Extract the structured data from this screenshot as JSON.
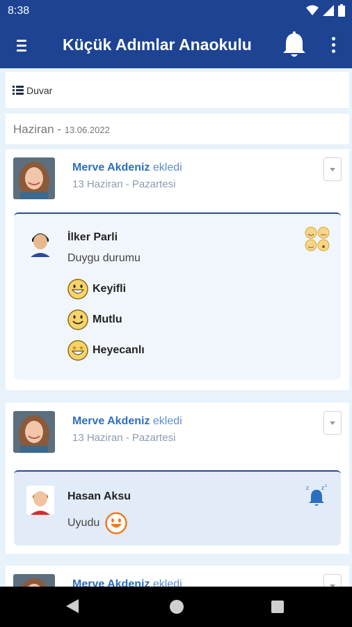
{
  "status": {
    "time": "8:38"
  },
  "app": {
    "title": "Küçük Adımlar Anaokulu"
  },
  "tabbar": {
    "label": "Duvar"
  },
  "month_header": {
    "month": "Haziran",
    "separator": "-",
    "date": "13.06.2022"
  },
  "posts": [
    {
      "author": "Merve Akdeniz",
      "verb": "ekledi",
      "when": "13 Haziran - Pazartesi",
      "child": "İlker Parli",
      "kind": "Duygu durumu",
      "moods": [
        "Keyifli",
        "Mutlu",
        "Heyecanlı"
      ]
    },
    {
      "author": "Merve Akdeniz",
      "verb": "ekledi",
      "when": "13 Haziran - Pazartesi",
      "child": "Hasan Aksu",
      "kind": "Uyudu"
    },
    {
      "author": "Merve Akdeniz",
      "verb": "ekledi"
    }
  ],
  "icons": {
    "menu": "hamburger-icon",
    "bell": "bell-icon",
    "more": "more-vert-icon",
    "list": "list-icon",
    "mood": "mood-faces-icon",
    "sleep": "sleep-bell-icon"
  },
  "colors": {
    "primary": "#1d4392",
    "link": "#2c6fbf",
    "background": "#e8f2fb"
  }
}
